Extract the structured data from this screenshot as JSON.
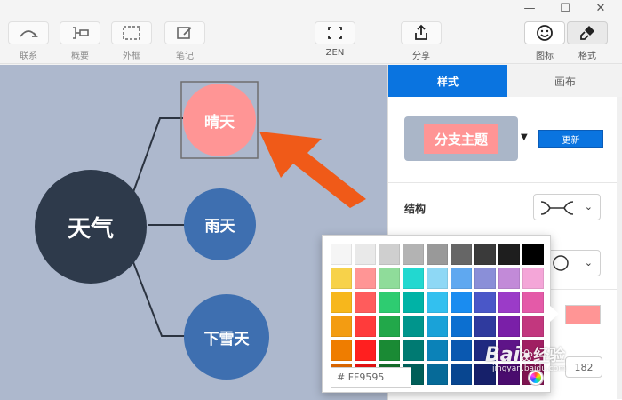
{
  "toolbar": {
    "items": [
      {
        "label": "联系"
      },
      {
        "label": "概要"
      },
      {
        "label": "外框"
      },
      {
        "label": "笔记"
      }
    ],
    "zen_label": "ZEN",
    "share_label": "分享",
    "icon_label": "图标",
    "format_label": "格式"
  },
  "mindmap": {
    "root": "天气",
    "branches": [
      "晴天",
      "雨天",
      "下雪天"
    ]
  },
  "panel": {
    "tabs": [
      "样式",
      "画布"
    ],
    "preview_text": "分支主题",
    "update_button": "更新",
    "structure_label": "结构",
    "border_width_value": "182",
    "fill_color": "#FF9595"
  },
  "color_picker": {
    "hex_value": "# FF9595",
    "swatches": [
      "#f5f5f5",
      "#e9e9e9",
      "#cfcfcf",
      "#b3b3b3",
      "#999999",
      "#666666",
      "#3a3a3a",
      "#1e1e1e",
      "#000000",
      "#f7d24a",
      "#ff9595",
      "#8fdc9a",
      "#22d8d0",
      "#8ed8f5",
      "#5fa8f0",
      "#8a8fd8",
      "#c28ad8",
      "#f4a6d8",
      "#f7b71c",
      "#ff5c5c",
      "#2ecc71",
      "#00b3a6",
      "#33c0ef",
      "#1a8cf0",
      "#4a57c8",
      "#9b3bc8",
      "#e45aa8",
      "#f39c12",
      "#ff3b3b",
      "#22a84a",
      "#00958c",
      "#1aa2d8",
      "#0c6fd0",
      "#2f3a9e",
      "#7a1fa8",
      "#c2377e",
      "#ef7d00",
      "#ff1f1f",
      "#1a8a34",
      "#007a72",
      "#0b82b8",
      "#0a58b0",
      "#1f2a80",
      "#5e1488",
      "#a01f62",
      "#d86500",
      "#e01010",
      "#146a28",
      "#005e58",
      "#066a98",
      "#084690",
      "#16206a",
      "#4a0c6e",
      "#7e1450"
    ]
  },
  "watermark": {
    "text": "Bai",
    "cn": "经验",
    "url": "jingyan.baidu.com"
  }
}
